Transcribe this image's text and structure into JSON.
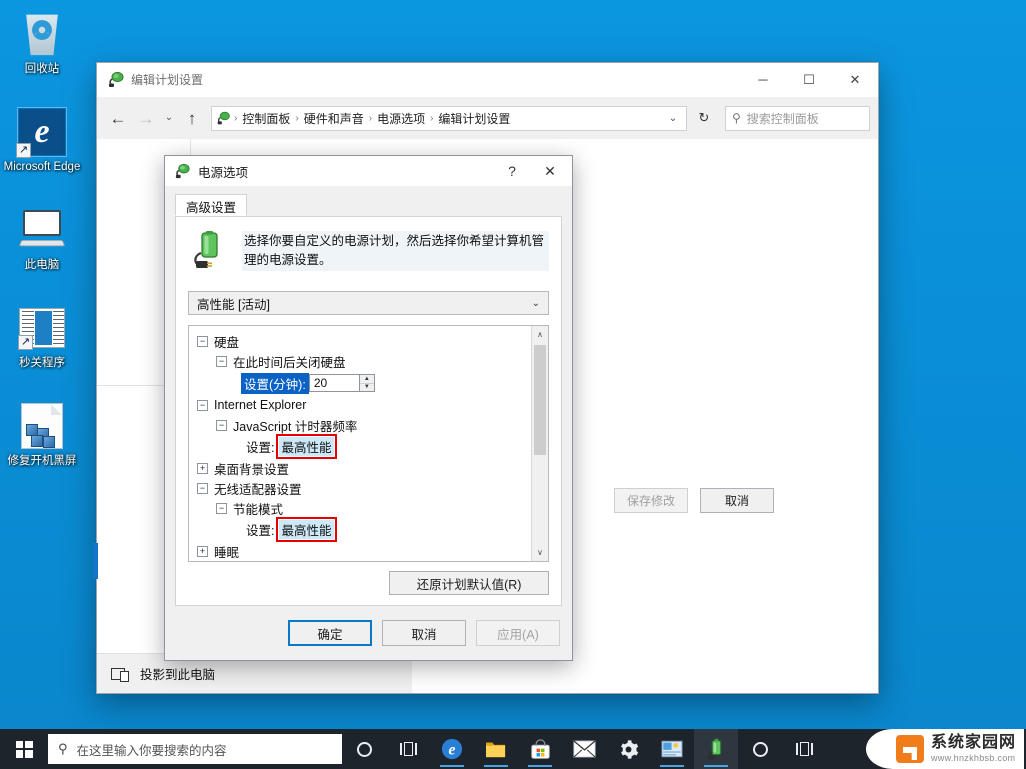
{
  "desktop": {
    "icons": [
      {
        "label": "回收站",
        "icon": "recycle-bin-icon",
        "selected": false
      },
      {
        "label": "Microsoft Edge",
        "icon": "edge-icon",
        "selected": true
      },
      {
        "label": "此电脑",
        "icon": "this-pc-icon",
        "selected": false
      },
      {
        "label": "秒关程序",
        "icon": "app-shortcut-icon",
        "selected": false
      },
      {
        "label": "修复开机黑屏",
        "icon": "document-cubes-icon",
        "selected": false
      }
    ]
  },
  "control_panel": {
    "title": "编辑计划设置",
    "title_icon": "power-plug-icon",
    "window_buttons": {
      "minimize": "─",
      "maximize": "☐",
      "close": "✕"
    },
    "nav": {
      "back": "←",
      "forward": "→",
      "recent": "⌄",
      "up": "↑",
      "refresh": "↻",
      "dropdown": "⌄"
    },
    "breadcrumb": [
      "控制面板",
      "硬件和声音",
      "电源选项",
      "编辑计划设置"
    ],
    "breadcrumb_separator": "›",
    "search": {
      "placeholder": "搜索控制面板",
      "icon": "search-icon"
    },
    "buttons": {
      "save": "保存修改",
      "cancel": "取消"
    },
    "footer": {
      "label": "投影到此电脑",
      "icon": "project-to-pc-icon"
    }
  },
  "dialog": {
    "title": "电源选项",
    "title_icon": "power-plug-icon",
    "help_button": "?",
    "close_button": "✕",
    "tab": "高级设置",
    "intro": "选择你要自定义的电源计划，然后选择你希望计算机管理的电源设置。",
    "intro_icon": "battery-plug-icon",
    "plan_select": {
      "value": "高性能 [活动]",
      "chevron": "⌄"
    },
    "tree": [
      {
        "indent": 0,
        "toggle": "minus",
        "label": "硬盘"
      },
      {
        "indent": 1,
        "toggle": "minus",
        "label": "在此时间后关闭硬盘"
      },
      {
        "indent": 2,
        "toggle": "none",
        "label": "设置(分钟):",
        "label_style": "selected-blue",
        "control": "spinner",
        "value": "20"
      },
      {
        "indent": 0,
        "toggle": "minus",
        "label": "Internet Explorer"
      },
      {
        "indent": 1,
        "toggle": "minus",
        "label": "JavaScript 计时器频率"
      },
      {
        "indent": 2,
        "toggle": "none",
        "label": "设置:",
        "value": "最高性能",
        "value_style": "selected-light",
        "highlight": "red-box"
      },
      {
        "indent": 0,
        "toggle": "plus",
        "label": "桌面背景设置"
      },
      {
        "indent": 0,
        "toggle": "minus",
        "label": "无线适配器设置"
      },
      {
        "indent": 1,
        "toggle": "minus",
        "label": "节能模式"
      },
      {
        "indent": 2,
        "toggle": "none",
        "label": "设置:",
        "value": "最高性能",
        "value_style": "selected-light",
        "highlight": "red-box"
      },
      {
        "indent": 0,
        "toggle": "plus",
        "label": "睡眠"
      }
    ],
    "scrollbar": {
      "up": "∧",
      "down": "∨"
    },
    "restore_button": "还原计划默认值(R)",
    "buttons": {
      "ok": "确定",
      "cancel": "取消",
      "apply": "应用(A)"
    },
    "toggle_glyphs": {
      "minus": "−",
      "plus": "+"
    }
  },
  "taskbar": {
    "start": "start-icon",
    "search": {
      "placeholder": "在这里输入你要搜索的内容",
      "icon": "search-icon"
    },
    "items": [
      {
        "name": "cortana-icon",
        "running": false,
        "active": false
      },
      {
        "name": "task-view-icon",
        "running": false,
        "active": false
      },
      {
        "name": "edge-icon",
        "running": true,
        "active": false
      },
      {
        "name": "file-explorer-icon",
        "running": true,
        "active": false
      },
      {
        "name": "microsoft-store-icon",
        "running": true,
        "active": false
      },
      {
        "name": "mail-icon",
        "running": false,
        "active": false
      },
      {
        "name": "settings-icon",
        "running": false,
        "active": false
      },
      {
        "name": "control-panel-icon",
        "running": true,
        "active": false
      },
      {
        "name": "power-options-icon",
        "running": true,
        "active": true
      },
      {
        "name": "cortana-icon-2",
        "running": false,
        "active": false
      },
      {
        "name": "task-view-icon-2",
        "running": false,
        "active": false
      }
    ],
    "watermark": {
      "title": "系统家园网",
      "url": "www.hnzkhbsb.com",
      "logo": "house-logo"
    }
  },
  "colors": {
    "desktop_blue": "#0a8ed6",
    "accent_blue": "#0b77c8",
    "selection_blue": "#0b62c5",
    "selection_light": "#cde8f6",
    "highlight_red": "#e60000",
    "taskbar": "#1d242b",
    "brand_orange": "#f07c1a"
  }
}
